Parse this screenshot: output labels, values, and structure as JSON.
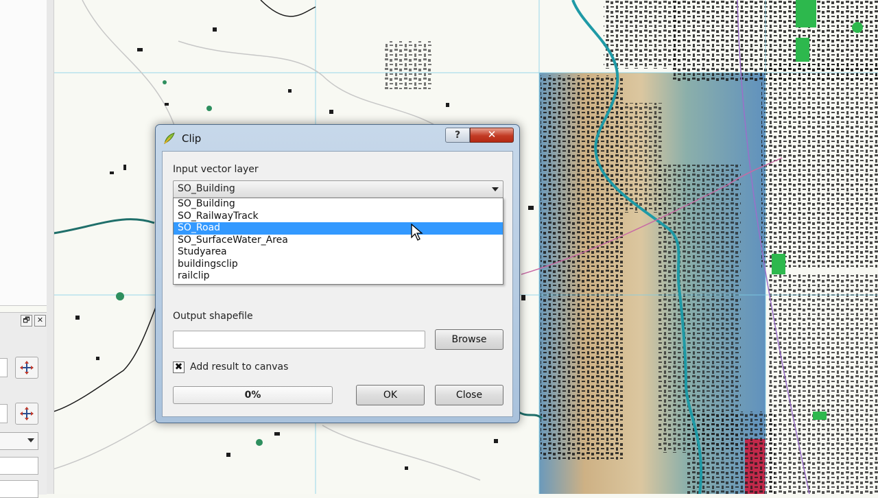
{
  "dialog": {
    "title": "Clip",
    "help_glyph": "?",
    "close_glyph": "✕",
    "input_layer_label": "Input vector layer",
    "input_layer_selected": "SO_Building",
    "dropdown_options": [
      "SO_Building",
      "SO_RailwayTrack",
      "SO_Road",
      "SO_SurfaceWater_Area",
      "Studyarea",
      "buildingsclip",
      "railclip"
    ],
    "dropdown_highlighted_index": 2,
    "output_label": "Output shapefile",
    "output_value": "",
    "browse_label": "Browse",
    "add_to_canvas_label": "Add result to canvas",
    "add_to_canvas_checked": true,
    "checkbox_glyph": "✖",
    "progress_text": "0%",
    "progress_value": 0.0,
    "ok_label": "OK",
    "close_label": "Close"
  },
  "dock": {
    "float_glyph": "🗗",
    "close_glyph": "✕"
  },
  "icons": {
    "app": "qgis-icon",
    "pan": "pan-icon",
    "cursor": "mouse-pointer"
  },
  "colors": {
    "selection": "#3399ff",
    "window_close": "#c23a24",
    "map_water": "#1f9aa6",
    "map_buildings": "#1c1c1c",
    "map_green": "#2db84d",
    "map_grid": "#7fd0e8"
  }
}
